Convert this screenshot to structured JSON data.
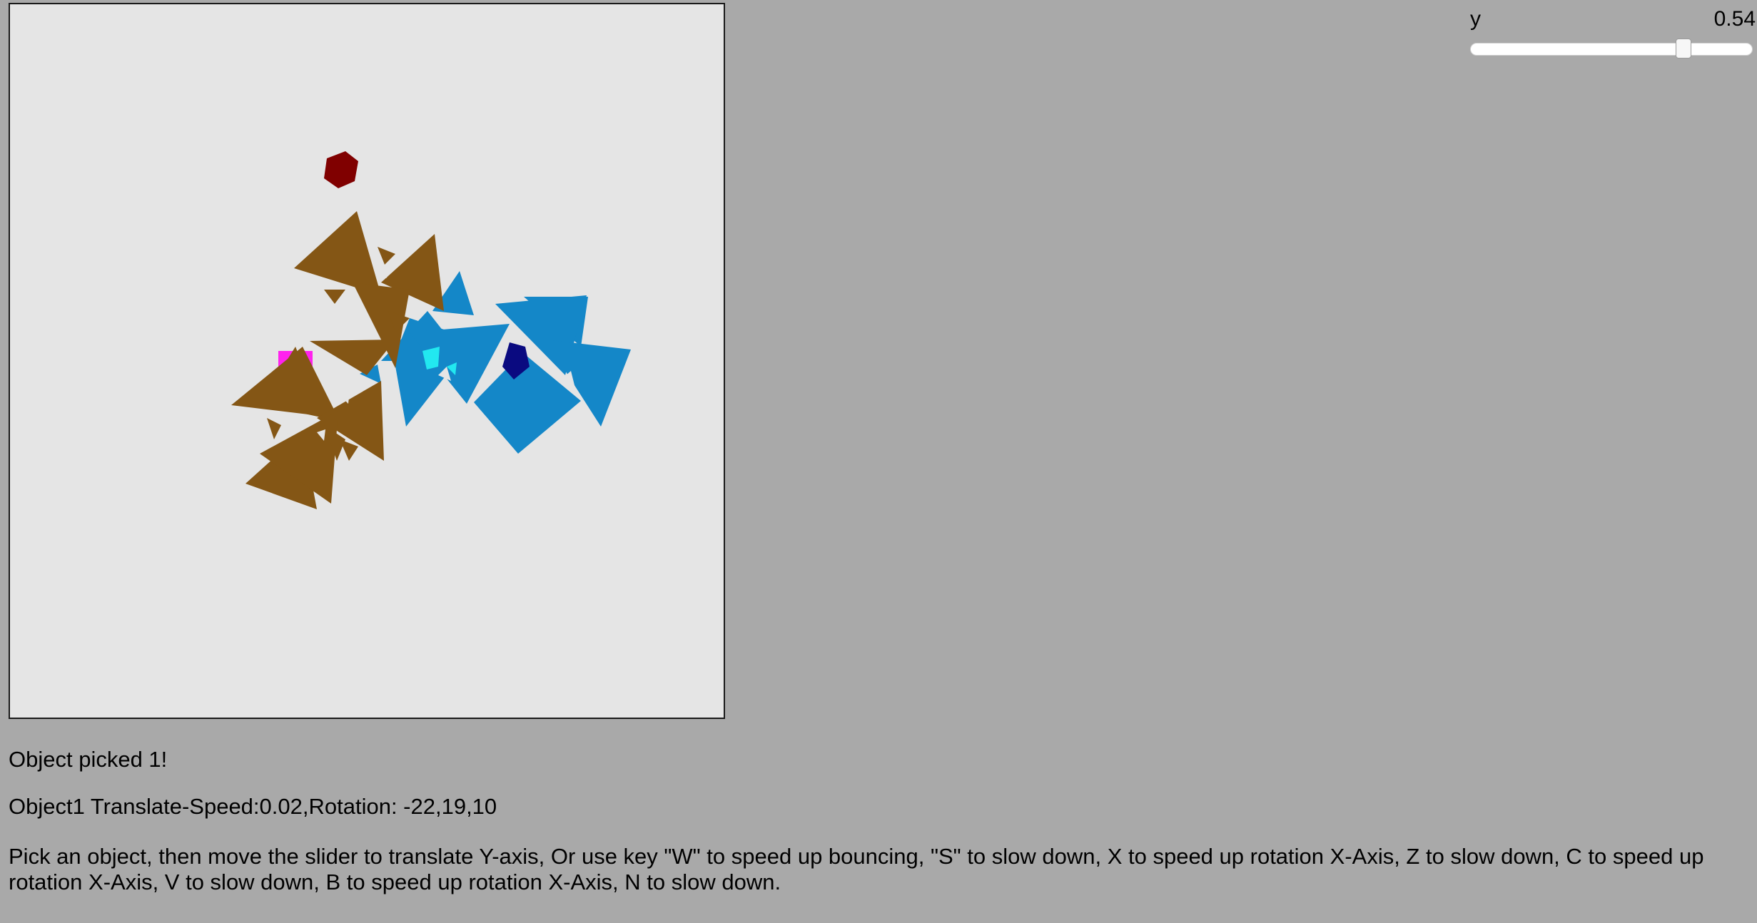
{
  "slider": {
    "label": "y",
    "value_text": "0.54",
    "value": 0.54,
    "min": -1,
    "max": 1
  },
  "status": {
    "picked": "Object picked 1!",
    "object_info": "Object1 Translate-Speed:0.02,Rotation: -22,19,10"
  },
  "instructions": "Pick an object, then move the slider to translate Y-axis, Or use key \"W\" to speed up bouncing, \"S\" to slow down, X to speed up rotation X-Axis, Z to slow down, C to speed up rotation X-Axis, V to slow down, B to speed up rotation X-Axis, N to slow down.",
  "scene": {
    "background": "#e5e5e5",
    "objects": [
      {
        "name": "red-hexagon",
        "color": "#800000"
      },
      {
        "name": "brown-triangle-cluster",
        "color": "#845615"
      },
      {
        "name": "blue-triangle-cluster",
        "color": "#1487c8"
      },
      {
        "name": "magenta-square",
        "color": "#ff22ee"
      },
      {
        "name": "cyan-shape",
        "color": "#22e8f0"
      },
      {
        "name": "navy-shape",
        "color": "#0a0a80"
      }
    ]
  }
}
